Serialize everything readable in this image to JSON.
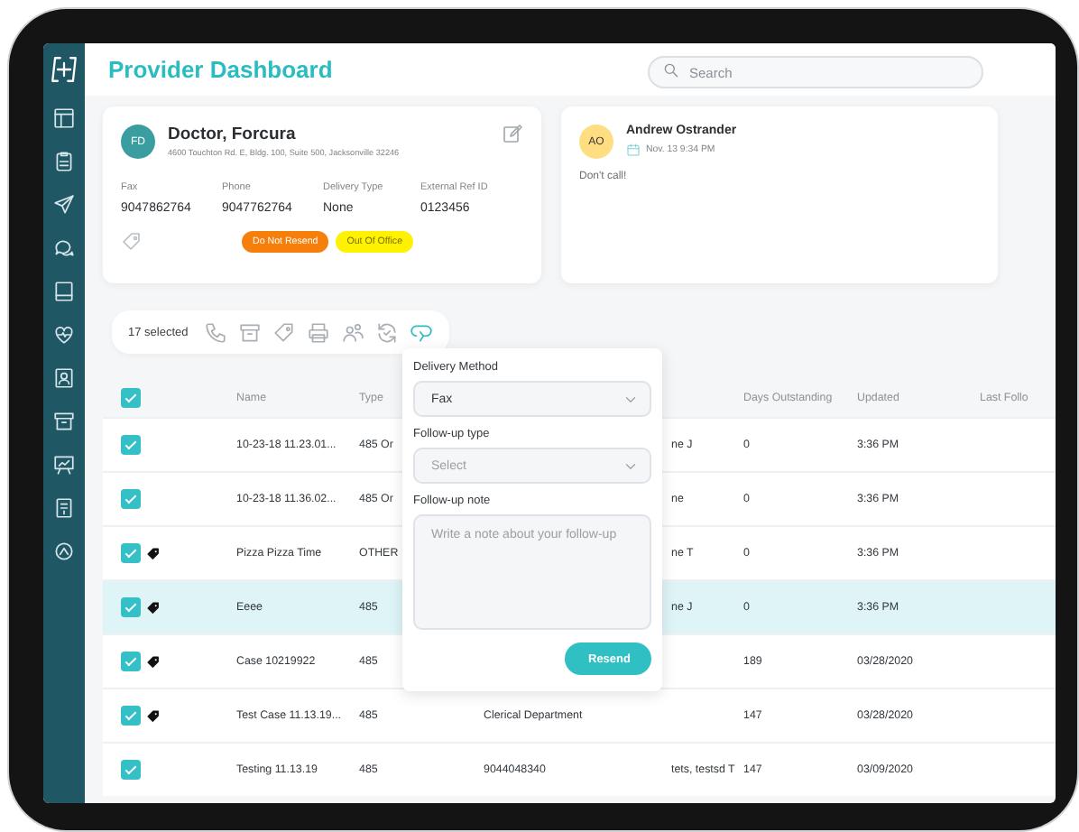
{
  "header": {
    "title": "Provider Dashboard",
    "search": {
      "placeholder": "Search"
    }
  },
  "provider_card": {
    "initials": "FD",
    "name": "Doctor, Forcura",
    "address": "4600 Touchton Rd. E, Bldg. 100, Suite 500, Jacksonville 32246",
    "fields": [
      {
        "label": "Fax",
        "value": "9047862764"
      },
      {
        "label": "Phone",
        "value": "9047762764"
      },
      {
        "label": "Delivery Type",
        "value": "None"
      },
      {
        "label": "External Ref ID",
        "value": "0123456"
      }
    ],
    "tags": [
      {
        "text": "Do Not Resend",
        "color": "#f57f0a"
      },
      {
        "text": "Out Of Office",
        "color": "#fff200"
      }
    ]
  },
  "note_card": {
    "initials": "AO",
    "author": "Andrew Ostrander",
    "date": "Nov. 13 9:34 PM",
    "text": "Don't call!"
  },
  "toolbar": {
    "selected_count": "17 selected",
    "actions": [
      {
        "kind": "phone",
        "selected": false
      },
      {
        "kind": "archive",
        "selected": false
      },
      {
        "kind": "tag",
        "selected": false
      },
      {
        "kind": "print",
        "selected": false
      },
      {
        "kind": "users",
        "selected": false
      },
      {
        "kind": "sync",
        "selected": false
      },
      {
        "kind": "resend",
        "selected": true
      }
    ]
  },
  "table": {
    "all_checked": true,
    "columns": [
      "Name",
      "Type",
      "Days Outstanding",
      "Updated",
      "Last Follo"
    ],
    "rows": [
      {
        "checked": true,
        "tagged": false,
        "selected": false,
        "name": "10-23-18 11.23.01...",
        "type": "485 Or",
        "column_4": "ne J",
        "days_outstanding": "0",
        "updated": "3:36 PM"
      },
      {
        "checked": true,
        "tagged": false,
        "selected": false,
        "name": "10-23-18 11.36.02...",
        "type": "485 Or",
        "column_4": "ne",
        "days_outstanding": "0",
        "updated": "3:36 PM"
      },
      {
        "checked": true,
        "tagged": true,
        "selected": false,
        "name": "Pizza Pizza Time",
        "type": "OTHER",
        "column_4": "ne T",
        "days_outstanding": "0",
        "updated": "3:36 PM"
      },
      {
        "checked": true,
        "tagged": true,
        "selected": true,
        "name": "Eeee",
        "type": "485",
        "column_4": "ne J",
        "days_outstanding": "0",
        "updated": "3:36 PM"
      },
      {
        "checked": true,
        "tagged": true,
        "selected": false,
        "name": "Case 10219922",
        "type": "485",
        "days_outstanding": "189",
        "updated": "03/28/2020"
      },
      {
        "checked": true,
        "tagged": true,
        "selected": false,
        "name": "Test Case 11.13.19...",
        "type": "485",
        "column_3": "Clerical Department",
        "days_outstanding": "147",
        "updated": "03/28/2020"
      },
      {
        "checked": true,
        "tagged": false,
        "selected": false,
        "name": "Testing 11.13.19",
        "type": "485",
        "column_3": "9044048340",
        "column_4": "tets, testsd T",
        "days_outstanding": "147",
        "updated": "03/09/2020"
      }
    ]
  },
  "resend_popup": {
    "fields": [
      {
        "kind": "select",
        "label": "Delivery Method",
        "value": "Fax"
      },
      {
        "kind": "select",
        "label": "Follow-up type",
        "placeholder": "Select"
      },
      {
        "kind": "textarea",
        "label": "Follow-up note",
        "placeholder": "Write a note about your follow-up"
      }
    ],
    "button": "Resend"
  }
}
